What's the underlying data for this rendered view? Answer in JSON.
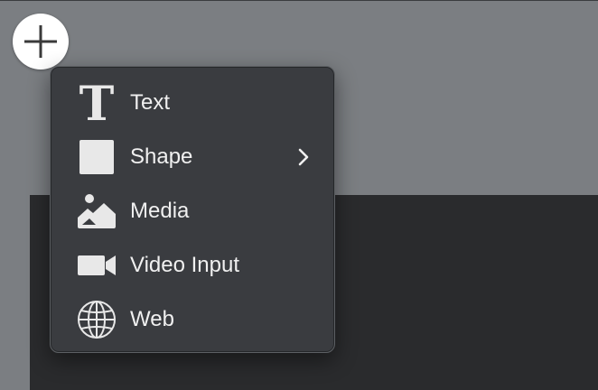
{
  "colors": {
    "background": "#7b7e82",
    "canvas": "#2a2b2d",
    "menu_background": "#3a3c40",
    "menu_text": "#f0f0f0",
    "icon": "#e8e8e8",
    "add_button": "#ffffff"
  },
  "add_button": {
    "icon": "plus-icon"
  },
  "insert_menu": {
    "items": [
      {
        "label": "Text",
        "icon": "text-icon",
        "has_submenu": false
      },
      {
        "label": "Shape",
        "icon": "shape-icon",
        "has_submenu": true
      },
      {
        "label": "Media",
        "icon": "media-icon",
        "has_submenu": false
      },
      {
        "label": "Video Input",
        "icon": "video-camera-icon",
        "has_submenu": false
      },
      {
        "label": "Web",
        "icon": "globe-icon",
        "has_submenu": false
      }
    ]
  }
}
